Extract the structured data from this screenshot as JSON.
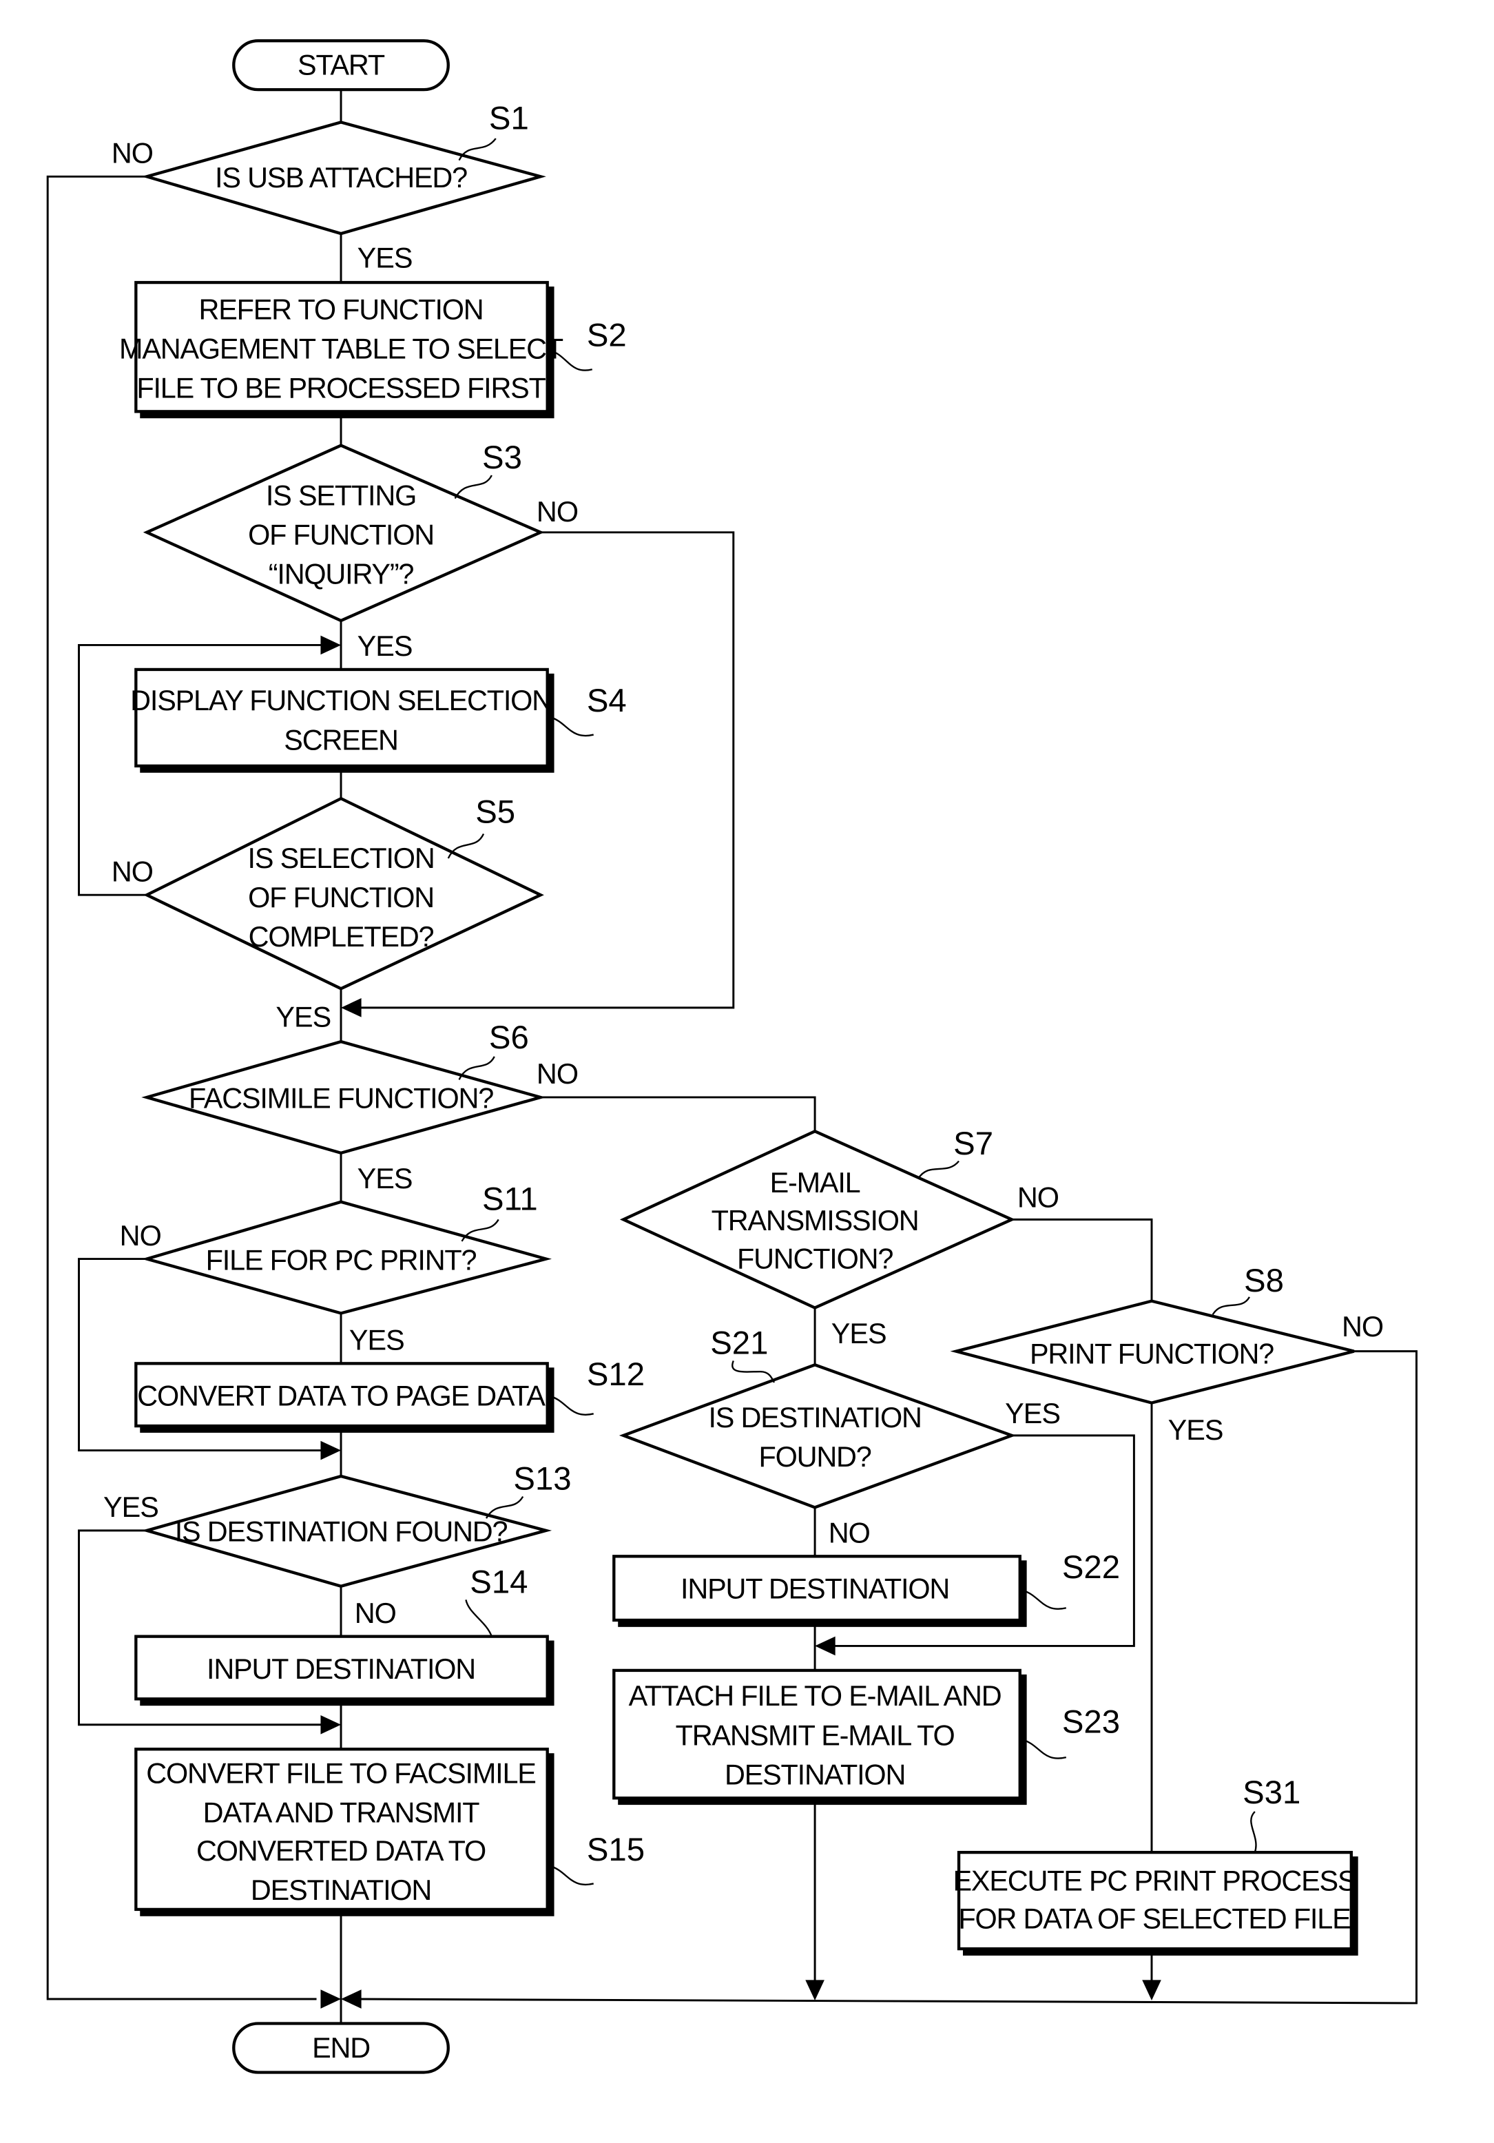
{
  "diagram": {
    "type": "flowchart",
    "terminals": {
      "start": "START",
      "end": "END"
    },
    "steps": {
      "S1": {
        "id": "S1",
        "kind": "decision",
        "lines": [
          "IS USB ATTACHED?"
        ]
      },
      "S2": {
        "id": "S2",
        "kind": "process",
        "lines": [
          "REFER TO FUNCTION",
          "MANAGEMENT TABLE TO SELECT",
          "FILE TO BE PROCESSED FIRST"
        ]
      },
      "S3": {
        "id": "S3",
        "kind": "decision",
        "lines": [
          "IS SETTING",
          "OF FUNCTION",
          "“INQUIRY”?"
        ]
      },
      "S4": {
        "id": "S4",
        "kind": "process",
        "lines": [
          "DISPLAY FUNCTION SELECTION",
          "SCREEN"
        ]
      },
      "S5": {
        "id": "S5",
        "kind": "decision",
        "lines": [
          "IS SELECTION",
          "OF FUNCTION",
          "COMPLETED?"
        ]
      },
      "S6": {
        "id": "S6",
        "kind": "decision",
        "lines": [
          "FACSIMILE FUNCTION?"
        ]
      },
      "S7": {
        "id": "S7",
        "kind": "decision",
        "lines": [
          "E-MAIL",
          "TRANSMISSION",
          "FUNCTION?"
        ]
      },
      "S8": {
        "id": "S8",
        "kind": "decision",
        "lines": [
          "PRINT FUNCTION?"
        ]
      },
      "S11": {
        "id": "S11",
        "kind": "decision",
        "lines": [
          "FILE FOR PC PRINT?"
        ]
      },
      "S12": {
        "id": "S12",
        "kind": "process",
        "lines": [
          "CONVERT DATA TO PAGE DATA"
        ]
      },
      "S13": {
        "id": "S13",
        "kind": "decision",
        "lines": [
          "IS DESTINATION FOUND?"
        ]
      },
      "S14": {
        "id": "S14",
        "kind": "process",
        "lines": [
          "INPUT DESTINATION"
        ]
      },
      "S15": {
        "id": "S15",
        "kind": "process",
        "lines": [
          "CONVERT FILE TO FACSIMILE",
          "DATA AND TRANSMIT",
          "CONVERTED DATA TO",
          "DESTINATION"
        ]
      },
      "S21": {
        "id": "S21",
        "kind": "decision",
        "lines": [
          "IS DESTINATION",
          "FOUND?"
        ]
      },
      "S22": {
        "id": "S22",
        "kind": "process",
        "lines": [
          "INPUT DESTINATION"
        ]
      },
      "S23": {
        "id": "S23",
        "kind": "process",
        "lines": [
          "ATTACH FILE TO E-MAIL AND",
          "TRANSMIT E-MAIL TO",
          "DESTINATION"
        ]
      },
      "S31": {
        "id": "S31",
        "kind": "process",
        "lines": [
          "EXECUTE PC PRINT PROCESS",
          "FOR DATA OF SELECTED FILE"
        ]
      }
    },
    "branch_labels": {
      "yes": "YES",
      "no": "NO"
    },
    "edges": [
      {
        "from": "START",
        "to": "S1"
      },
      {
        "from": "S1",
        "to": "S2",
        "label": "YES"
      },
      {
        "from": "S1",
        "to": "END",
        "label": "NO"
      },
      {
        "from": "S2",
        "to": "S3"
      },
      {
        "from": "S3",
        "to": "S4",
        "label": "YES"
      },
      {
        "from": "S3",
        "to": "S6",
        "label": "NO"
      },
      {
        "from": "S4",
        "to": "S5"
      },
      {
        "from": "S5",
        "to": "S6",
        "label": "YES"
      },
      {
        "from": "S5",
        "to": "S4",
        "label": "NO"
      },
      {
        "from": "S6",
        "to": "S11",
        "label": "YES"
      },
      {
        "from": "S6",
        "to": "S7",
        "label": "NO"
      },
      {
        "from": "S7",
        "to": "S21",
        "label": "YES"
      },
      {
        "from": "S7",
        "to": "S8",
        "label": "NO"
      },
      {
        "from": "S8",
        "to": "S31",
        "label": "YES"
      },
      {
        "from": "S8",
        "to": "END",
        "label": "NO"
      },
      {
        "from": "S11",
        "to": "S12",
        "label": "YES"
      },
      {
        "from": "S11",
        "to": "S13",
        "label": "NO"
      },
      {
        "from": "S12",
        "to": "S13"
      },
      {
        "from": "S13",
        "to": "S14",
        "label": "NO"
      },
      {
        "from": "S13",
        "to": "S15",
        "label": "YES"
      },
      {
        "from": "S14",
        "to": "S15"
      },
      {
        "from": "S15",
        "to": "END"
      },
      {
        "from": "S21",
        "to": "S22",
        "label": "NO"
      },
      {
        "from": "S21",
        "to": "S23",
        "label": "YES"
      },
      {
        "from": "S22",
        "to": "S23"
      },
      {
        "from": "S23",
        "to": "END"
      },
      {
        "from": "S31",
        "to": "END"
      }
    ]
  }
}
